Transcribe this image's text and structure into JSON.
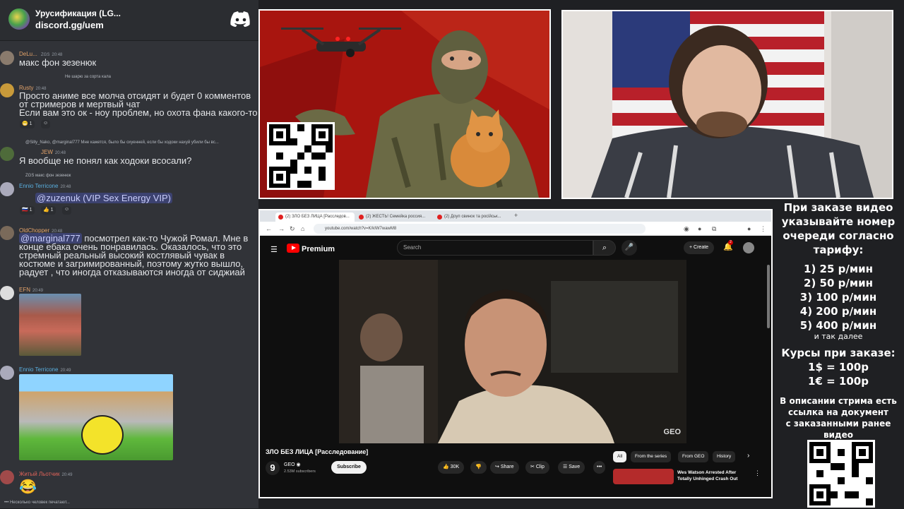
{
  "discord": {
    "server_name": "Урусификация (LG...",
    "server_link": "discord.gg/uem",
    "messages": [
      {
        "user": "DeLu...",
        "badge": "ZGS",
        "time": "20:48",
        "text": "макс фон зезенюк"
      },
      {
        "reply_to": "Не шарю за сорта кала",
        "user": "Rusty",
        "time": "20:48",
        "lines": [
          "Просто аниме все молча отсидят и будет 0 комментов",
          "от стримеров и мертвый чат",
          "Если вам это ок - ноу проблем, но охота фана какого-то"
        ],
        "reactions": [
          "1",
          ""
        ]
      },
      {
        "reply_to": "@Silly_Nako, @marginal777 Мне кажется, было бы охуенней, если бы ходоки нахуй убили бы вс...",
        "badge": "JEW",
        "time": "20:48",
        "text": "Я вообще не понял как ходоки всосали?"
      },
      {
        "reply_to": "ZGS макс фон зезенюк",
        "user": "Ennio Terricone",
        "time": "20:48",
        "mention": "@zuzenuk (VIP Sex Energy VIP)",
        "reactions": [
          "1",
          "1",
          ""
        ]
      },
      {
        "user": "OldChopper",
        "time": "20:48",
        "mention": "@marginal777",
        "lines": [
          "посмотрел как-то Чужой Ромал. Мне в",
          "конце ебака очень понравилась. Оказалось, что это",
          "стремный реальный высокий костлявый чувак в",
          "костюме и загримированный, поэтому жутко вышло,",
          "радует , что иногда отказываются иногда от сиджиай"
        ]
      },
      {
        "user": "EFN",
        "time": "20:49"
      },
      {
        "user": "Ennio Terricone",
        "time": "20:49"
      },
      {
        "user": "Житый Льотчик",
        "time": "20:49"
      }
    ],
    "typing": "Несколько человек печатают..."
  },
  "browser": {
    "tabs": [
      "(2) ЗЛО БЕЗ ЛИЦА [Расследов...",
      "(2) ЖЕСТЬ! Семейка россия...",
      "(2) Доуп свинок та російськ..."
    ],
    "url": "youtube.com/watch?v=K/kIW7wawM8"
  },
  "youtube": {
    "brand": "Premium",
    "search_placeholder": "Search",
    "create_label": "Create",
    "notifications": "2",
    "video_title": "ЗЛО БЕЗ ЛИЦА [Расследование]",
    "watermark": "GEO",
    "channel_initial": "9",
    "channel_name": "GEO",
    "subscribers": "2.53M subscribers",
    "subscribe_label": "Subscribe",
    "likes": "30K",
    "share_label": "Share",
    "clip_label": "Clip",
    "save_label": "Save",
    "chips": [
      "All",
      "From the series",
      "From GEO",
      "History"
    ],
    "recommendation_title": "Wes Watson Arrested After Totally Unhinged Crash Out"
  },
  "info": {
    "header_lines": [
      "При заказе видео",
      "указывайте номер",
      "очереди согласно",
      "тарифу:"
    ],
    "tariffs": [
      "1) 25 р/мин",
      "2) 50 р/мин",
      "3) 100 р/мин",
      "4) 200 р/мин",
      "5) 400 р/мин"
    ],
    "etc": "и так далее",
    "rates_title": "Курсы при заказе:",
    "rates": [
      "1$ = 100р",
      "1€ = 100р"
    ],
    "desc_lines": [
      "В описании стрима есть",
      "ссылка на документ",
      "с заказанными ранее",
      "видео"
    ]
  },
  "colors": {
    "youtube_red": "#ff0000",
    "discord_bg": "#313338",
    "art_red": "#b01a16"
  }
}
